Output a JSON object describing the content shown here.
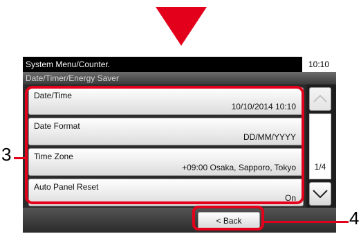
{
  "header": {
    "title": "System Menu/Counter.",
    "time": "10:10"
  },
  "breadcrumb": "Date/Timer/Energy Saver",
  "items": [
    {
      "label": "Date/Time",
      "value": "10/10/2014 10:10"
    },
    {
      "label": "Date Format",
      "value": "DD/MM/YYYY"
    },
    {
      "label": "Time Zone",
      "value": "+09:00 Osaka, Sapporo, Tokyo"
    },
    {
      "label": "Auto Panel Reset",
      "value": "On"
    }
  ],
  "pagination": {
    "page": "1/4"
  },
  "footer": {
    "back_label": "< Back"
  },
  "callouts": {
    "list": "3",
    "back": "4"
  },
  "colors": {
    "highlight": "#e3001b",
    "screen": "#1e1e1e"
  },
  "icons": {
    "scroll_up": "chevron-up-icon",
    "scroll_down": "chevron-down-icon",
    "pointer": "down-arrow-icon"
  }
}
